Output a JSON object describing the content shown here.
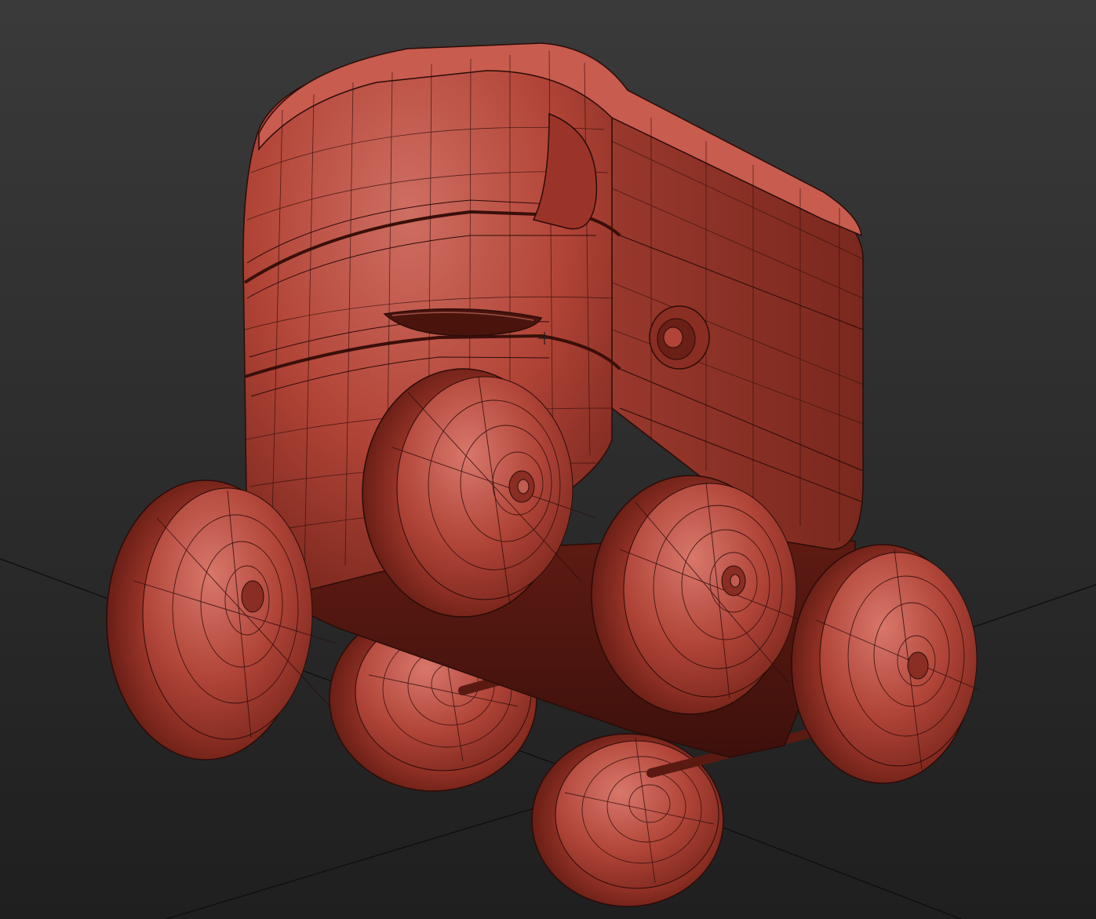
{
  "viewport": {
    "background_top": "#3a3a3a",
    "background_bottom": "#1f1f1f",
    "grid_line_color": "#0e0e0e"
  },
  "model": {
    "base_color": "#b5483c",
    "highlight_color": "#d8776b",
    "shadow_color": "#6e2119",
    "wire_color": "#2a0c08",
    "wheel_count": 6,
    "display_mode": "smooth-shaded-with-wireframe"
  }
}
